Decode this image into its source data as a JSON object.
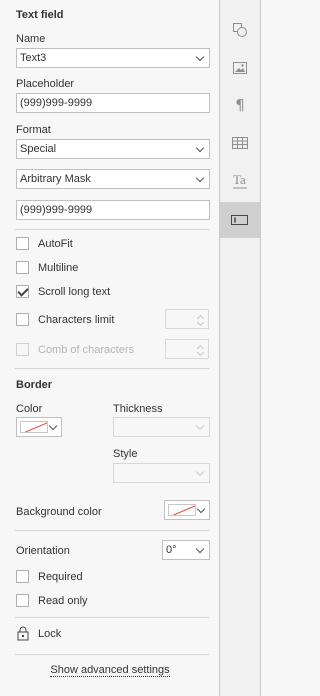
{
  "panel": {
    "title": "Text field",
    "name": {
      "label": "Name",
      "value": "Text3"
    },
    "placeholder": {
      "label": "Placeholder",
      "value": "(999)999-9999"
    },
    "format": {
      "label": "Format",
      "value": "Special",
      "mask_type": "Arbitrary Mask",
      "mask_value": "(999)999-9999"
    },
    "checks": {
      "autofit": {
        "label": "AutoFit",
        "checked": false
      },
      "multiline": {
        "label": "Multiline",
        "checked": false
      },
      "scroll": {
        "label": "Scroll long text",
        "checked": true
      },
      "chars_limit": {
        "label": "Characters limit",
        "checked": false
      },
      "comb": {
        "label": "Comb of characters",
        "checked": false,
        "disabled": true
      }
    },
    "border": {
      "title": "Border",
      "color_label": "Color",
      "thickness_label": "Thickness",
      "style_label": "Style"
    },
    "background": {
      "label": "Background color"
    },
    "orientation": {
      "label": "Orientation",
      "value": "0°"
    },
    "required": {
      "label": "Required",
      "checked": false
    },
    "read_only": {
      "label": "Read only",
      "checked": false
    },
    "lock": {
      "label": "Lock"
    },
    "advanced": {
      "label": "Show advanced settings"
    }
  },
  "rail": {
    "icons": [
      "shape-icon",
      "image-icon",
      "paragraph-icon",
      "table-icon",
      "text-art-icon",
      "form-field-icon"
    ],
    "active": "form-field-icon"
  },
  "colors": {
    "no_color_line": "#e33c3c",
    "active_rail": "#cfcfcf"
  }
}
